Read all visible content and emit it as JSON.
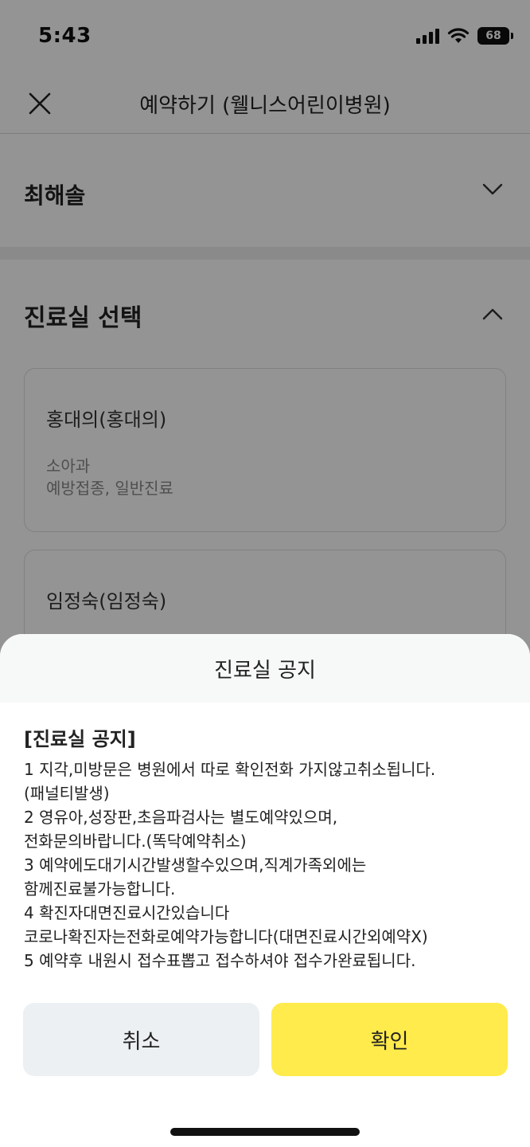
{
  "status_bar": {
    "time": "5:43",
    "battery": "68",
    "icons": [
      "signal-icon",
      "wifi-icon",
      "battery-icon"
    ]
  },
  "nav": {
    "title": "예약하기 (웰니스어린이병원)",
    "close_icon": "close-icon"
  },
  "patient": {
    "name": "최해솔",
    "icon": "chevron-down-icon"
  },
  "clinic_section": {
    "title": "진료실 선택",
    "icon": "chevron-up-icon",
    "cards": [
      {
        "name": "홍대의(홍대의)",
        "department": "소아과",
        "services": "예방접종, 일반진료"
      },
      {
        "name": "임정숙(임정숙)"
      }
    ]
  },
  "modal": {
    "header": "진료실 공지",
    "notice_title": "[진료실 공지]",
    "lines": [
      "1 지각,미방문은 병원에서 따로 확인전화 가지않고취소됩니다.",
      "(패널티발생)",
      "2 영유아,성장판,초음파검사는 별도예약있으며,",
      "전화문의바랍니다.(똑닥예약취소)",
      "3 예약에도대기시간발생할수있으며,직계가족외에는",
      "함께진료불가능합니다.",
      "4 확진자대면진료시간있습니다",
      "코로나확진자는전화로예약가능합니다(대면진료시간외예약X)",
      "5  예약후 내원시 접수표뽑고 접수하셔야 접수가완료됩니다."
    ],
    "cancel_label": "취소",
    "confirm_label": "확인"
  },
  "colors": {
    "confirm_bg": "#ffeb4b",
    "cancel_bg": "#edf0f3",
    "overlay": "rgba(0,0,0,0.42)"
  }
}
